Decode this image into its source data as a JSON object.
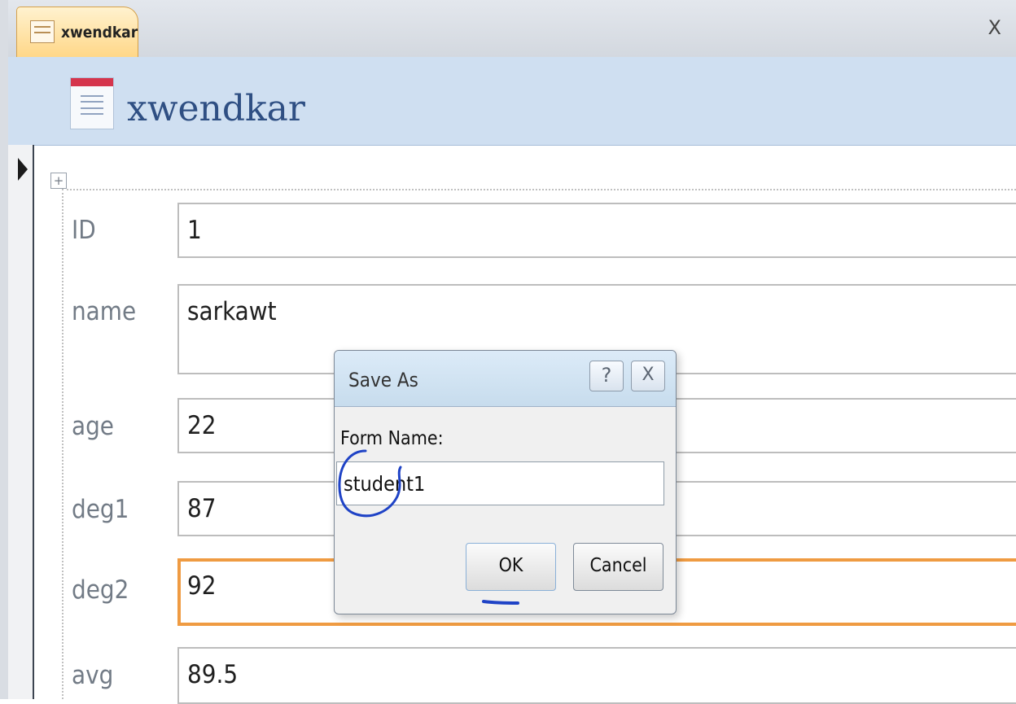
{
  "tab": {
    "label": "xwendkar",
    "close_glyph": "X"
  },
  "form_header": {
    "title": "xwendkar"
  },
  "icons": {
    "tab": "form-icon",
    "header": "form-icon",
    "record": "record-selector-arrow-icon",
    "layout": "move-layout-icon",
    "help": "help-icon",
    "close": "close-icon"
  },
  "fields": [
    {
      "label": "ID",
      "value": "1"
    },
    {
      "label": "name",
      "value": "sarkawt"
    },
    {
      "label": "age",
      "value": "22"
    },
    {
      "label": "deg1",
      "value": "87"
    },
    {
      "label": "deg2",
      "value": "92"
    },
    {
      "label": "avg",
      "value": "89.5"
    }
  ],
  "dialog": {
    "title": "Save As",
    "help_glyph": "?",
    "close_glyph": "X",
    "field_label": "Form Name:",
    "field_value": "student1",
    "ok_label": "OK",
    "cancel_label": "Cancel"
  },
  "annotations": {
    "ink_color": "#1f43c6"
  },
  "colors": {
    "tab_fill": "#ffd788",
    "header_fill": "#cfdff1",
    "selected_field_border": "#ef9b42"
  }
}
